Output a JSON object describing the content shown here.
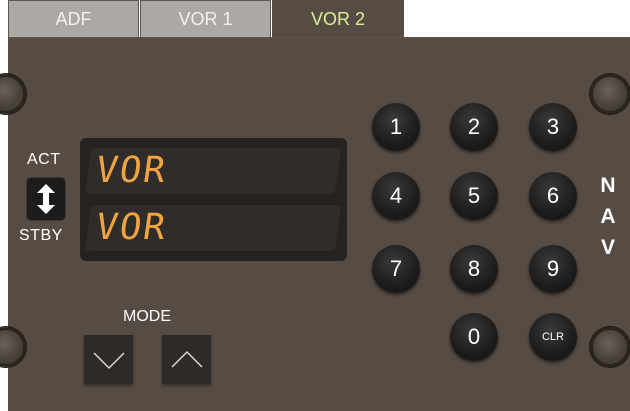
{
  "tabs": [
    {
      "label": "ADF",
      "active": false
    },
    {
      "label": "VOR 1",
      "active": false
    },
    {
      "label": "VOR 2",
      "active": true
    }
  ],
  "swap": {
    "act_label": "ACT",
    "stby_label": "STBY"
  },
  "display": {
    "active": "VOR",
    "standby": "VOR",
    "color": "#f0a441"
  },
  "mode": {
    "label": "MODE"
  },
  "keypad": {
    "k1": "1",
    "k2": "2",
    "k3": "3",
    "k4": "4",
    "k5": "5",
    "k6": "6",
    "k7": "7",
    "k8": "8",
    "k9": "9",
    "k0": "0",
    "clr": "CLR"
  },
  "side_label": {
    "n": "N",
    "a": "A",
    "v": "V"
  },
  "colors": {
    "panel": "#574c44",
    "active_tab_text": "#d9ef97",
    "inactive_tab": "#aca8a3"
  }
}
